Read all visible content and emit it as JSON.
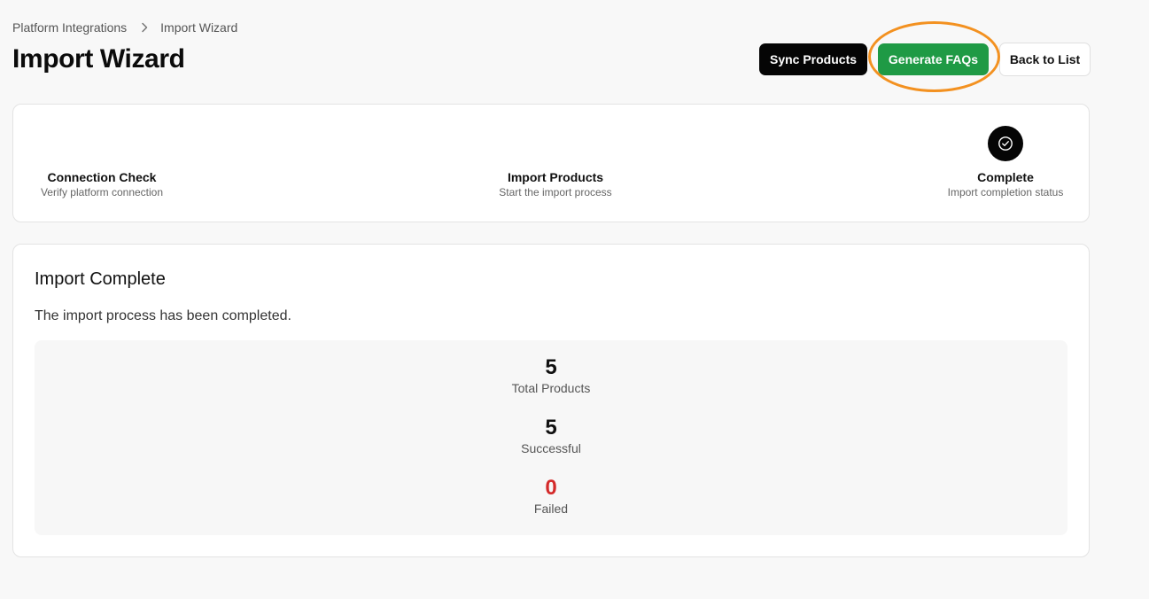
{
  "breadcrumb": {
    "parent": "Platform Integrations",
    "current": "Import Wizard"
  },
  "header": {
    "title": "Import Wizard",
    "sync_label": "Sync Products",
    "faq_label": "Generate FAQs",
    "back_label": "Back to List"
  },
  "steps": [
    {
      "label": "Connection Check",
      "description": "Verify platform connection"
    },
    {
      "label": "Import Products",
      "description": "Start the import process"
    },
    {
      "label": "Complete",
      "description": "Import completion status",
      "icon": "check-circle-icon"
    }
  ],
  "result": {
    "title": "Import Complete",
    "description": "The import process has been completed.",
    "stats": [
      {
        "value": "5",
        "label": "Total Products"
      },
      {
        "value": "5",
        "label": "Successful"
      },
      {
        "value": "0",
        "label": "Failed"
      }
    ]
  },
  "colors": {
    "primary_dark": "#050505",
    "success_green": "#1f9a45",
    "failed_red": "#d42a2a",
    "highlight_orange": "#f39120"
  }
}
